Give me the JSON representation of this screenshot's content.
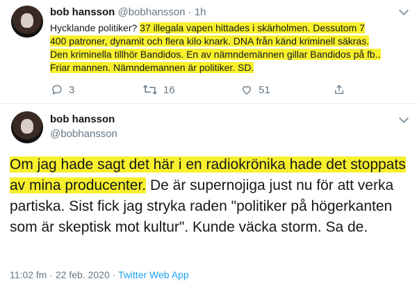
{
  "tweet1": {
    "name": "bob hansson",
    "handle": "@bobhansson",
    "separator": "·",
    "time": "1h",
    "text_prefix": "Hycklande politiker? ",
    "text_highlighted": "37 illegala vapen hittades i skärholmen. Dessutom 7 400 patroner, dynamit och flera kilo knark. DNA från känd kriminell säkras. Den kriminella tillhör Bandidos. En av nämndemännen gillar Bandidos på fb.. Friar mannen. Nämndemannen är politiker. SD.",
    "reply_count": "3",
    "retweet_count": "16",
    "like_count": "51"
  },
  "tweet2": {
    "name": "bob hansson",
    "handle": "@bobhansson",
    "text_highlighted": "Om jag hade sagt det här i en radiokrönika hade det stoppats av mina producenter.",
    "text_rest": " De är supernojiga just nu för att verka partiska. Sist fick jag stryka raden \"politiker på högerkanten som är skeptisk mot kultur\". Kunde väcka storm. Sa de.",
    "timestamp": "11:02 fm · 22 feb. 2020 · ",
    "source": "Twitter Web App"
  },
  "colors": {
    "highlight": "#f8f02c",
    "muted": "#657786",
    "link": "#1da1f2"
  },
  "icons": [
    "reply-icon",
    "retweet-icon",
    "like-icon",
    "share-icon",
    "chevron-down-icon"
  ]
}
